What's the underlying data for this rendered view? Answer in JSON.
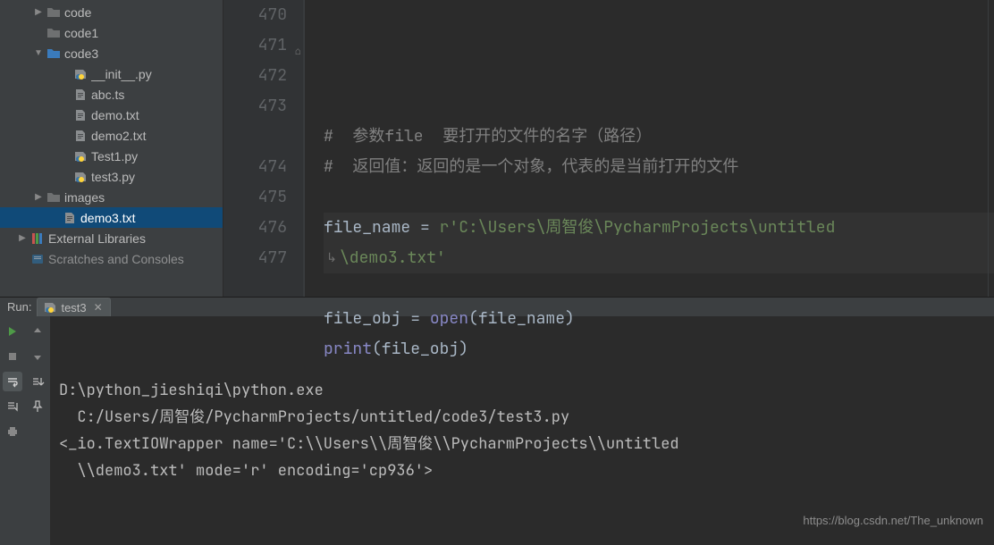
{
  "sidebar": {
    "items": [
      {
        "indent": 24,
        "arrow": "closed",
        "iconType": "folder-dark",
        "label": "code"
      },
      {
        "indent": 24,
        "arrow": "none",
        "iconType": "folder-dark",
        "label": "code1"
      },
      {
        "indent": 24,
        "arrow": "open",
        "iconType": "folder-blue",
        "label": "code3"
      },
      {
        "indent": 54,
        "arrow": "none",
        "iconType": "python",
        "label": "__init__.py"
      },
      {
        "indent": 54,
        "arrow": "none",
        "iconType": "file",
        "label": "abc.ts"
      },
      {
        "indent": 54,
        "arrow": "none",
        "iconType": "file",
        "label": "demo.txt"
      },
      {
        "indent": 54,
        "arrow": "none",
        "iconType": "file",
        "label": "demo2.txt"
      },
      {
        "indent": 54,
        "arrow": "none",
        "iconType": "python",
        "label": "Test1.py"
      },
      {
        "indent": 54,
        "arrow": "none",
        "iconType": "python",
        "label": "test3.py"
      },
      {
        "indent": 24,
        "arrow": "closed",
        "iconType": "folder-dark",
        "label": "images"
      },
      {
        "indent": 42,
        "arrow": "none",
        "iconType": "file",
        "label": "demo3.txt",
        "selected": true
      },
      {
        "indent": 6,
        "arrow": "closed",
        "iconType": "libs",
        "label": "External Libraries"
      },
      {
        "indent": 6,
        "arrow": "none",
        "iconType": "scratch",
        "label": "Scratches and Consoles",
        "dim": true
      }
    ]
  },
  "editor": {
    "lines": [
      {
        "num": "470",
        "segments": [
          {
            "cls": "tok-comment",
            "text": "#  参数file  要打开的文件的名字（路径）"
          }
        ]
      },
      {
        "num": "471",
        "segments": [
          {
            "cls": "tok-comment",
            "text": "#  返回值：返回的是一个对象，代表的是当前打开的文件"
          }
        ]
      },
      {
        "num": "472",
        "segments": []
      },
      {
        "num": "473",
        "current": true,
        "segments": [
          {
            "cls": "",
            "text": "file_name "
          },
          {
            "cls": "tok-op",
            "text": "= "
          },
          {
            "cls": "tok-str",
            "text": "r'C:\\Users\\周智俊\\PycharmProjects\\untitled"
          }
        ]
      },
      {
        "num": "",
        "current": true,
        "wrap": true,
        "segments": [
          {
            "cls": "tok-str",
            "text": "\\demo3.txt'"
          }
        ]
      },
      {
        "num": "474",
        "segments": []
      },
      {
        "num": "475",
        "segments": [
          {
            "cls": "",
            "text": "file_obj "
          },
          {
            "cls": "tok-op",
            "text": "= "
          },
          {
            "cls": "tok-builtin",
            "text": "open"
          },
          {
            "cls": "",
            "text": "(file_name)"
          }
        ]
      },
      {
        "num": "476",
        "segments": [
          {
            "cls": "tok-builtin",
            "text": "print"
          },
          {
            "cls": "",
            "text": "(file_obj)"
          }
        ]
      },
      {
        "num": "477",
        "segments": []
      }
    ]
  },
  "run": {
    "label": "Run:",
    "tab": {
      "icon": "python",
      "label": "test3"
    },
    "console": [
      "D:\\python_jieshiqi\\python.exe ",
      "  C:/Users/周智俊/PycharmProjects/untitled/code3/test3.py",
      "<_io.TextIOWrapper name='C:\\\\Users\\\\周智俊\\\\PycharmProjects\\\\untitled",
      "  \\\\demo3.txt' mode='r' encoding='cp936'>",
      ""
    ]
  },
  "watermark": "https://blog.csdn.net/The_unknown"
}
